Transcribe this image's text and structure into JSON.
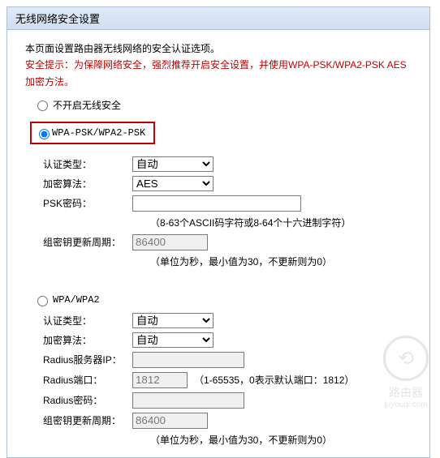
{
  "window": {
    "title": "无线网络安全设置"
  },
  "intro": {
    "line1": "本页面设置路由器无线网络的安全认证选项。",
    "tip": "安全提示：为保障网络安全，强烈推荐开启安全设置，并使用WPA-PSK/WPA2-PSK AES加密方法。"
  },
  "options": {
    "opt1_label": "不开启无线安全",
    "opt2_label": "WPA-PSK/WPA2-PSK",
    "opt3_label": "WPA/WPA2",
    "selected": "opt2"
  },
  "psk_section": {
    "auth_label": "认证类型：",
    "auth_value": "自动",
    "enc_label": "加密算法：",
    "enc_value": "AES",
    "psk_label": "PSK密码：",
    "psk_value": "",
    "psk_note": "（8-63个ASCII码字符或8-64个十六进制字符）",
    "rekey_label": "组密钥更新周期：",
    "rekey_value": "86400",
    "rekey_note": "（单位为秒，最小值为30，不更新则为0）"
  },
  "wpa_section": {
    "auth_label": "认证类型：",
    "auth_value": "自动",
    "enc_label": "加密算法：",
    "enc_value": "自动",
    "radius_ip_label": "Radius服务器IP：",
    "radius_ip_value": "",
    "radius_port_label": "Radius端口：",
    "radius_port_value": "1812",
    "radius_port_note": "（1-65535，0表示默认端口：1812）",
    "radius_pw_label": "Radius密码：",
    "radius_pw_value": "",
    "rekey_label": "组密钥更新周期：",
    "rekey_value": "86400",
    "rekey_note": "（单位为秒，最小值为30，不更新则为0）"
  },
  "watermark": {
    "text": "路由器",
    "url": "luyouqi.com"
  }
}
